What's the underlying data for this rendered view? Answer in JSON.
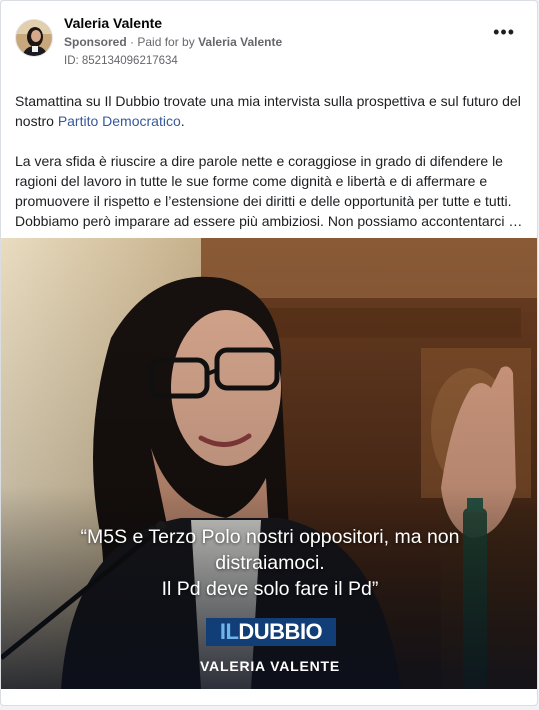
{
  "post": {
    "page_name": "Valeria Valente",
    "sponsored": "Sponsored",
    "separator": "·",
    "paid_for_prefix": "Paid for by",
    "paid_for_name": "Valeria Valente",
    "ad_id": "ID: 852134096217634",
    "more_label": "•••",
    "para1_before": "Stamattina su Il Dubbio trovate una mia intervista sulla prospettiva e sul futuro del nostro ",
    "para1_link": "Partito Democratico",
    "para1_after": ".",
    "para2_lines": [
      "La vera sfida è riuscire a dire parole nette e coraggiose in grado di difendere le",
      "ragioni del lavoro in tutte le sue forme come dignità e libertà e di affermare e",
      "promuovere il rispetto e l’estensione dei diritti e delle opportunità per tutte e tutti.",
      "Dobbiamo però imparare ad essere più ambiziosi. Non possiamo accontentarci di…"
    ]
  },
  "image": {
    "quote_lines": [
      "“M5S e Terzo Polo nostri oppositori, ma non",
      "distraiamoci.",
      "Il Pd deve solo fare il Pd”"
    ],
    "logo_prefix": "IL",
    "logo_main": "DUBBIO",
    "caption_name": "VALERIA VALENTE"
  },
  "colors": {
    "link": "#385898",
    "logo_bg": "#123e77",
    "logo_prefix": "#6fb5ea"
  }
}
